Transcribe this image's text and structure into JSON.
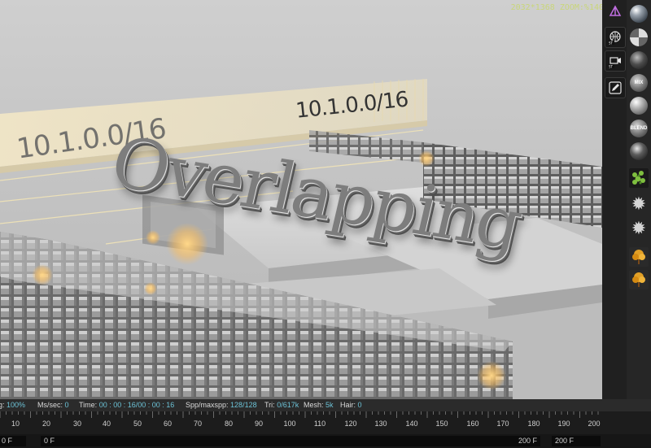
{
  "viewport": {
    "title_3d": "Overlapping",
    "ip_left": "10.1.0.0/16",
    "ip_right": "10.1.0.0/16",
    "resolution_readout": "2032*1368 ZOOM:%140"
  },
  "toolbar": {
    "left_buttons": [
      "node-network-icon",
      "render-settings-icon",
      "camera-settings-icon",
      "edit-icon"
    ],
    "material_buttons": [
      {
        "icon": "glossy-sphere-icon",
        "label": ""
      },
      {
        "icon": "checker-sphere-icon",
        "label": ""
      },
      {
        "icon": "dark-sphere-icon",
        "label": ""
      },
      {
        "icon": "mix-sphere-icon",
        "label": "MIX"
      },
      {
        "icon": "metallic-sphere-icon",
        "label": ""
      },
      {
        "icon": "blend-sphere-icon",
        "label": "BLEND"
      },
      {
        "icon": "toon-sphere-icon",
        "label": ""
      },
      {
        "icon": "scatter-icon",
        "label": ""
      },
      {
        "icon": "gear-icon",
        "label": ""
      },
      {
        "icon": "gear-icon",
        "label": ""
      },
      {
        "icon": "tree-icon",
        "label": ""
      },
      {
        "icon": "tree-icon",
        "label": ""
      }
    ]
  },
  "status": {
    "progress_label": "g:",
    "progress_value": "100%",
    "ms_label": "Ms/sec:",
    "ms_value": "0",
    "time_label": "Time:",
    "time_value": "00 : 00 : 16/00 : 00 : 16",
    "spp_label": "Spp/maxspp:",
    "spp_value": "128/128",
    "tri_label": "Tri:",
    "tri_value": "0/617k",
    "mesh_label": "Mesh:",
    "mesh_value": "5k",
    "hair_label": "Hair:",
    "hair_value": "0"
  },
  "timeline": {
    "ticks": [
      "10",
      "20",
      "30",
      "40",
      "50",
      "60",
      "70",
      "80",
      "90",
      "100",
      "110",
      "120",
      "130",
      "140",
      "150",
      "160",
      "170",
      "180",
      "190",
      "200"
    ],
    "start_field": "0 F",
    "start_value": "0 F",
    "end_value": "200 F",
    "end_field": "200 F"
  }
}
